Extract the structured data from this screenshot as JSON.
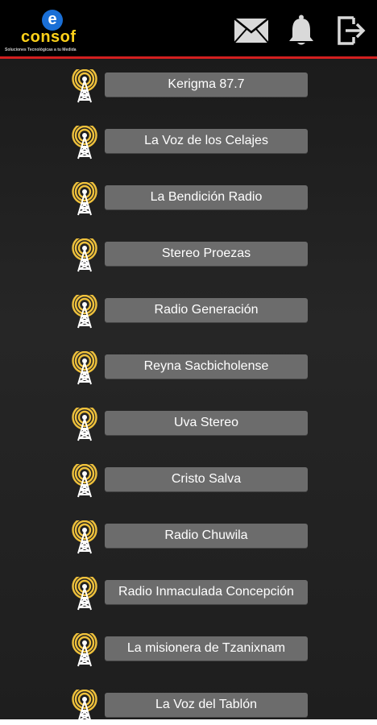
{
  "app": {
    "logo_mark": "e",
    "logo_name": "consof",
    "logo_tagline": "Soluciones Tecnológicas a tu Medida"
  },
  "header": {
    "actions": [
      {
        "name": "mail-icon"
      },
      {
        "name": "bell-icon"
      },
      {
        "name": "logout-icon"
      }
    ],
    "accent_color": "#d21f1f",
    "icon_color": "#d9d9d9"
  },
  "stations": [
    {
      "label": "Kerigma 87.7"
    },
    {
      "label": "La Voz de los Celajes"
    },
    {
      "label": "La Bendición Radio"
    },
    {
      "label": "Stereo Proezas"
    },
    {
      "label": "Radio Generación"
    },
    {
      "label": "Reyna Sacbicholense"
    },
    {
      "label": "Uva Stereo"
    },
    {
      "label": "Cristo Salva"
    },
    {
      "label": "Radio Chuwila"
    },
    {
      "label": "Radio Inmaculada Concepción"
    },
    {
      "label": "La misionera de Tzanixnam"
    },
    {
      "label": "La Voz del Tablón"
    }
  ],
  "colors": {
    "button_bg": "#6c6c6c",
    "tower_color": "#f0c23c"
  }
}
